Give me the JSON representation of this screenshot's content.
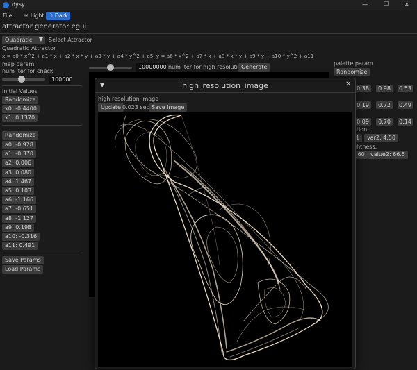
{
  "titlebar": {
    "app_name": "dysy",
    "min_symbol": "—",
    "max_symbol": "☐",
    "close_symbol": "✕"
  },
  "menubar": {
    "file": "File",
    "light_theme": "☀ Light",
    "dark_theme": "☽ Dark"
  },
  "heading": "attractor generator egui",
  "attractor": {
    "dropdown_value": "Quadratic",
    "select_label": "Select Attractor",
    "name": "Quadratic Attractor",
    "formula": "x = a0 * x^2 + a1 * x + a2 * x * y + a3 * y + a4 * y^2 + a5, y = a6 * x^2 + a7 * x + a8 * x * y + a9 * y + a10 * y^2 + a11"
  },
  "map_param": {
    "title": "map param",
    "num_iter_label": "num iter for check",
    "num_iter_value": "100000",
    "slider_level": 0.45
  },
  "initial_values": {
    "title": "Initial Values",
    "randomize": "Randomize",
    "x0": "x0: -0.4400",
    "x1": "x1: 0.1370"
  },
  "params": {
    "randomize": "Randomize",
    "items": [
      "a0: -0.928",
      "a1: -0.370",
      "a2: 0.006",
      "a3: 0.080",
      "a4: 1.467",
      "a5: 0.103",
      "a6: -1.166",
      "a7: -0.651",
      "a8: -1.127",
      "a9: 0.198",
      "a10: -0.316",
      "a11: 0.491"
    ],
    "save": "Save Params",
    "load": "Load Params"
  },
  "center_controls": {
    "iter_value": "10000000",
    "iter_label": "num iter for high resolution",
    "generate": "Generate",
    "slider_level": 0.5
  },
  "palette": {
    "title": "palette param",
    "randomize": "Randomize",
    "row1": [
      "0.38",
      "0.98",
      "0.53"
    ],
    "row2": [
      "0.19",
      "0.72",
      "0.49"
    ],
    "row3": [
      "0.09",
      "0.70",
      "0.14"
    ],
    "var_label": "ation:",
    "var1": "1",
    "var2": "var2: 4.50",
    "bright_label": "ghtness:",
    "val1": ".60",
    "val2": "value2: 66.5"
  },
  "hires_window": {
    "title": "high_resolution_image",
    "collapse_symbol": "▼",
    "close_symbol": "✕",
    "section_label": "high resolution image",
    "update": "Update",
    "time": "0.023 sec",
    "save_image": "Save Image"
  },
  "colors": {
    "accent": "#2a6ed0",
    "window_bg": "#1b1b1b",
    "button_bg": "#3c3c3c",
    "attractor_stroke": "#f5e6d2"
  }
}
